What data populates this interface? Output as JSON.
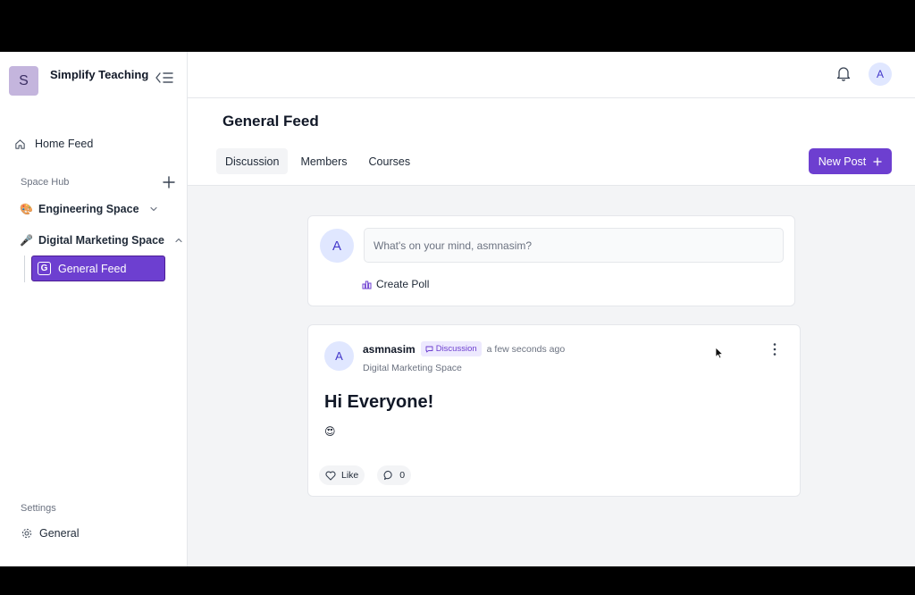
{
  "sidebar": {
    "brand_initial": "S",
    "brand_name": "Simplify Teaching",
    "home_feed": "Home Feed",
    "space_hub_label": "Space Hub",
    "spaces": [
      {
        "emoji": "🎨",
        "name": "Engineering Space",
        "expanded": false
      },
      {
        "emoji": "🎤",
        "name": "Digital Marketing Space",
        "expanded": true
      }
    ],
    "active_channel_badge": "G",
    "active_channel": "General Feed",
    "settings_label": "Settings",
    "settings_general": "General"
  },
  "topbar": {
    "user_initial": "A"
  },
  "header": {
    "title": "General Feed",
    "tabs": [
      "Discussion",
      "Members",
      "Courses"
    ],
    "active_tab": "Discussion",
    "new_post_label": "New Post"
  },
  "composer": {
    "avatar_initial": "A",
    "placeholder": "What's on your mind, asmnasim?",
    "create_poll": "Create Poll"
  },
  "post": {
    "avatar_initial": "A",
    "author": "asmnasim",
    "badge": "Discussion",
    "time": "a few seconds ago",
    "space": "Digital Marketing Space",
    "title": "Hi Everyone!",
    "body_emoji": "😍",
    "like_label": "Like",
    "comment_count": "0"
  },
  "colors": {
    "accent": "#6d3fd0",
    "avatar_bg": "#e0e7ff",
    "brand_avatar_bg": "#c4b5dd"
  }
}
